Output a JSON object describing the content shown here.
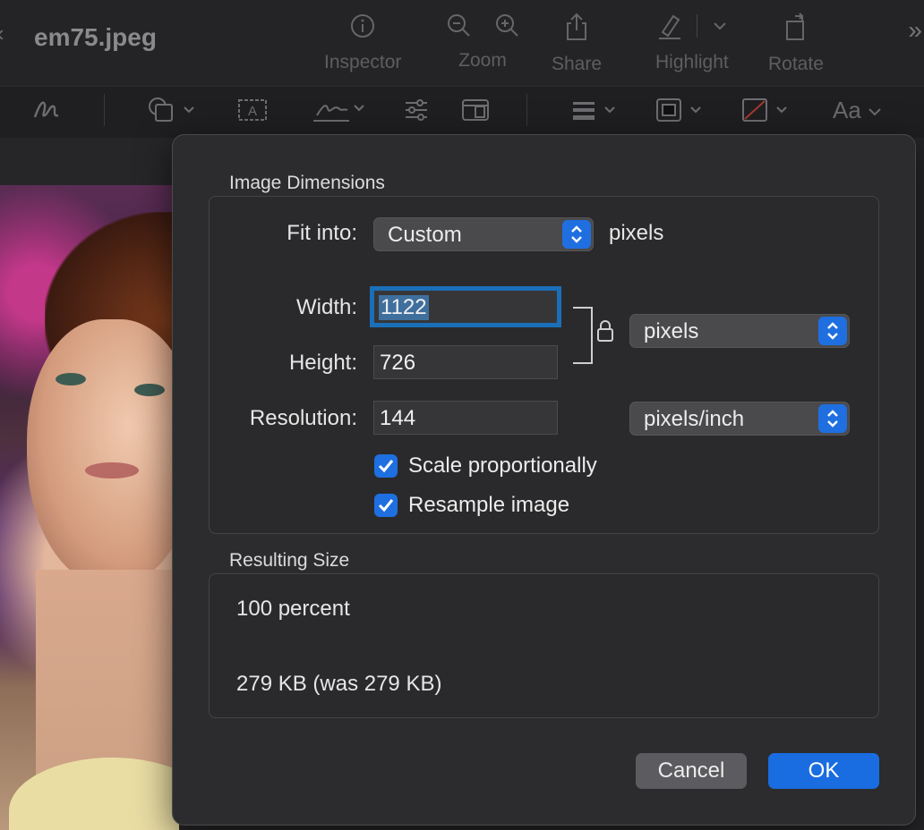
{
  "window": {
    "title": "em75.jpeg"
  },
  "toolbar": {
    "inspector_label": "Inspector",
    "zoom_label": "Zoom",
    "share_label": "Share",
    "highlight_label": "Highlight",
    "rotate_label": "Rotate",
    "font_button_label": "Aa"
  },
  "dialog": {
    "image_dimensions_title": "Image Dimensions",
    "fit_into_label": "Fit into:",
    "fit_into_value": "Custom",
    "fit_into_unit": "pixels",
    "width_label": "Width:",
    "width_value": "1122",
    "height_label": "Height:",
    "height_value": "726",
    "resolution_label": "Resolution:",
    "resolution_value": "144",
    "size_unit_value": "pixels",
    "resolution_unit_value": "pixels/inch",
    "scale_proportionally_label": "Scale proportionally",
    "scale_proportionally_checked": true,
    "resample_label": "Resample image",
    "resample_checked": true,
    "resulting_size_title": "Resulting Size",
    "result_percent": "100 percent",
    "result_size": "279 KB (was 279 KB)",
    "cancel_label": "Cancel",
    "ok_label": "OK"
  },
  "colors": {
    "accent": "#1a6de0",
    "focus_ring": "#1b6fb8",
    "sheet_background": "#2c2c2e"
  }
}
